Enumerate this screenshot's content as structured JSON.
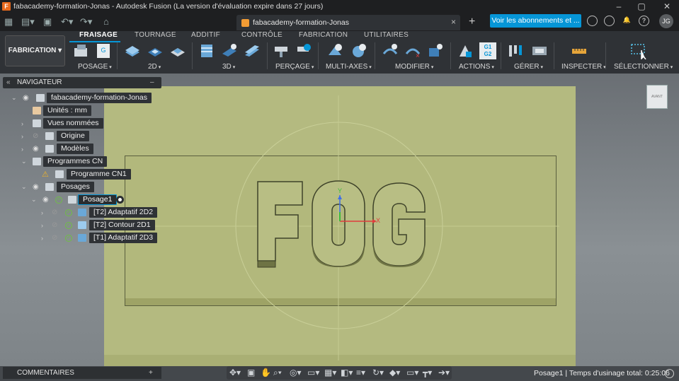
{
  "window": {
    "title": "fabacademy-formation-Jonas - Autodesk Fusion (La version d'évaluation expire dans 27 jours)",
    "logo_letter": "F",
    "minimize": "–",
    "maximize": "▢",
    "close": "✕"
  },
  "document_tab": {
    "label": "fabacademy-formation-Jonas",
    "close": "×"
  },
  "header": {
    "new_tab": "+",
    "subscribe_button": "Voir les abonnements et ...",
    "avatar_initials": "JG"
  },
  "ribbon": {
    "workspace": "FABRICATION",
    "tabs": [
      "FRAISAGE",
      "TOURNAGE",
      "ADDITIF",
      "CONTRÔLE",
      "FABRICATION",
      "UTILITAIRES"
    ],
    "groups": [
      "POSAGE",
      "2D",
      "3D",
      "PERÇAGE",
      "MULTI-AXES",
      "MODIFIER",
      "ACTIONS",
      "GÉRER",
      "INSPECTER",
      "SÉLECTIONNER"
    ],
    "actions_badge": "G1\nG2"
  },
  "navigator": {
    "title": "NAVIGATEUR",
    "items": [
      {
        "label": "fabacademy-formation-Jonas"
      },
      {
        "label": "Unités : mm"
      },
      {
        "label": "Vues nommées"
      },
      {
        "label": "Origine"
      },
      {
        "label": "Modèles"
      },
      {
        "label": "Programmes CN"
      },
      {
        "label": "Programme CN1"
      },
      {
        "label": "Posages"
      },
      {
        "label": "Posage1"
      },
      {
        "label": "[T2] Adaptatif 2D2"
      },
      {
        "label": "[T2] Contour 2D1"
      },
      {
        "label": "[T1] Adaptatif 2D3"
      }
    ]
  },
  "viewport": {
    "model_text": "FOG",
    "axis_x": "X",
    "axis_y": "Y"
  },
  "viewcube": {
    "face": "AVANT"
  },
  "comments": {
    "title": "COMMENTAIRES",
    "add": "+"
  },
  "status": {
    "text": "Posage1 | Temps d'usinage total: 0:25:06"
  },
  "colors": {
    "accent": "#0696d7",
    "stock": "#b4ba80",
    "background": "#2b2e31"
  }
}
